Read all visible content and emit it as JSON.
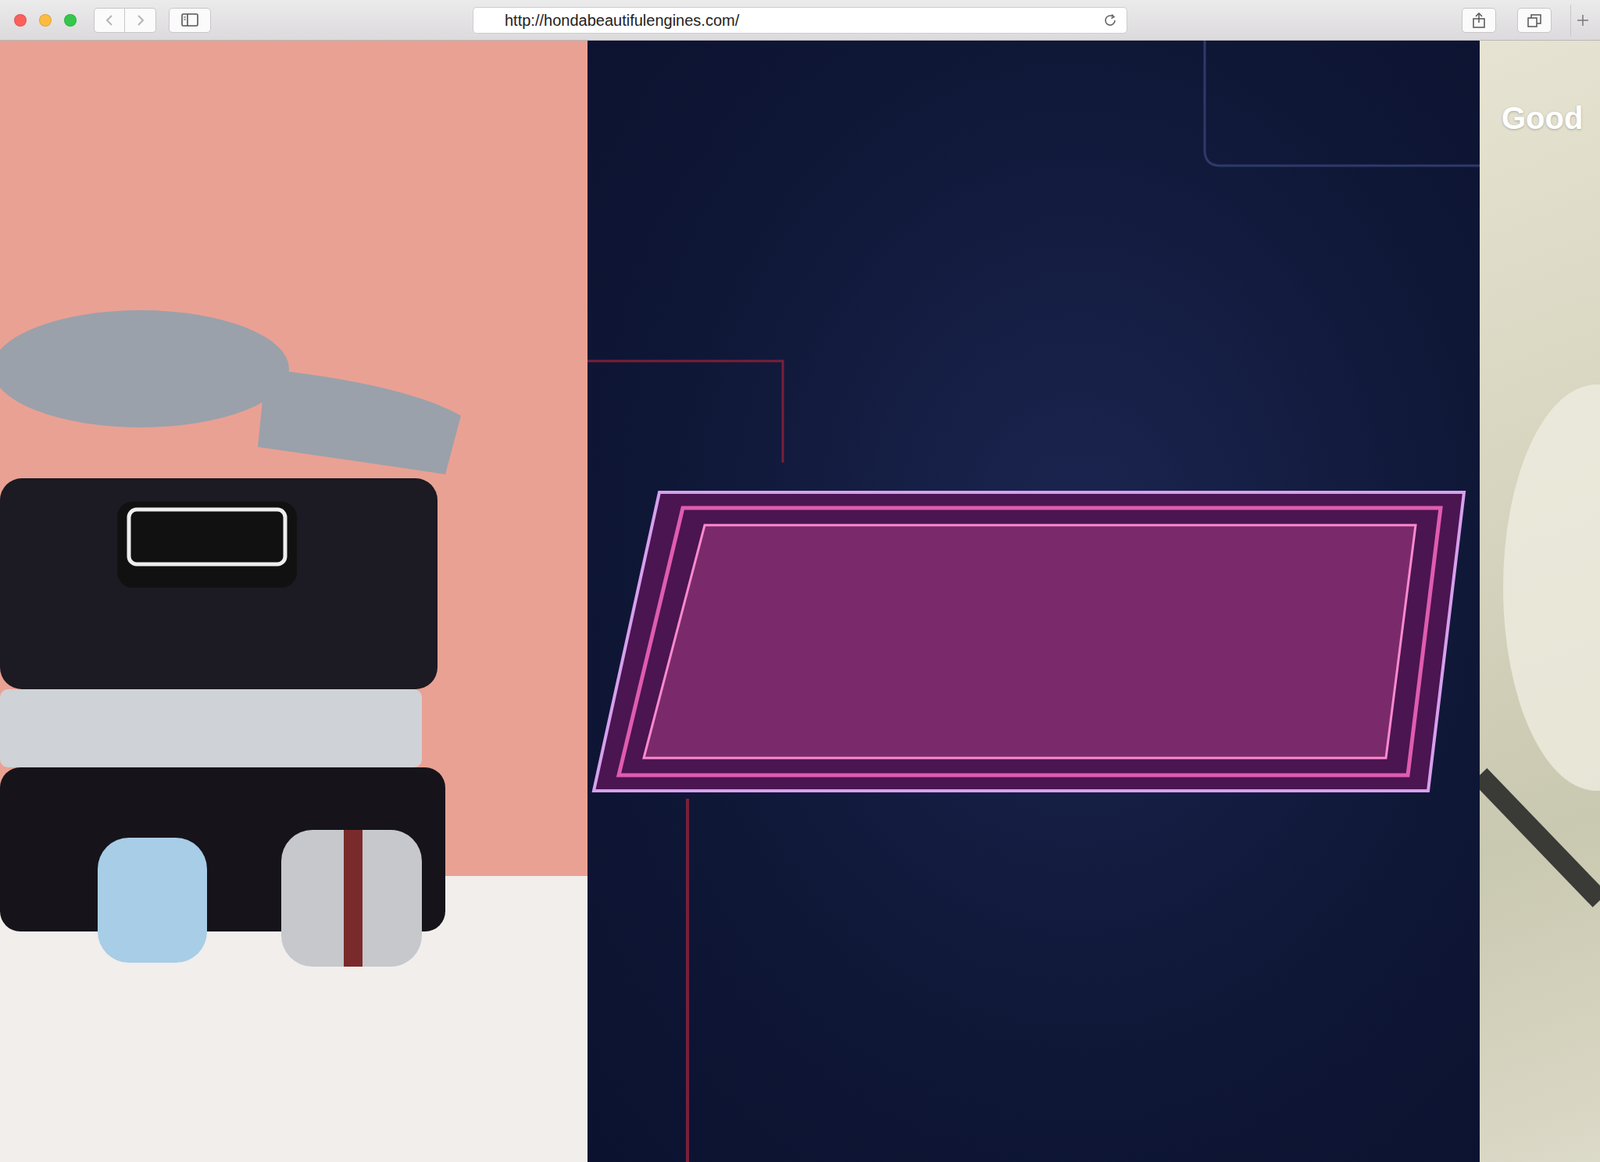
{
  "browser": {
    "url": "http://hondabeautifulengines.com/"
  },
  "panels": [
    {
      "kind": "photo"
    },
    {
      "kind": "poster"
    },
    {
      "kind": "backdrop",
      "heading": "Good"
    }
  ]
}
